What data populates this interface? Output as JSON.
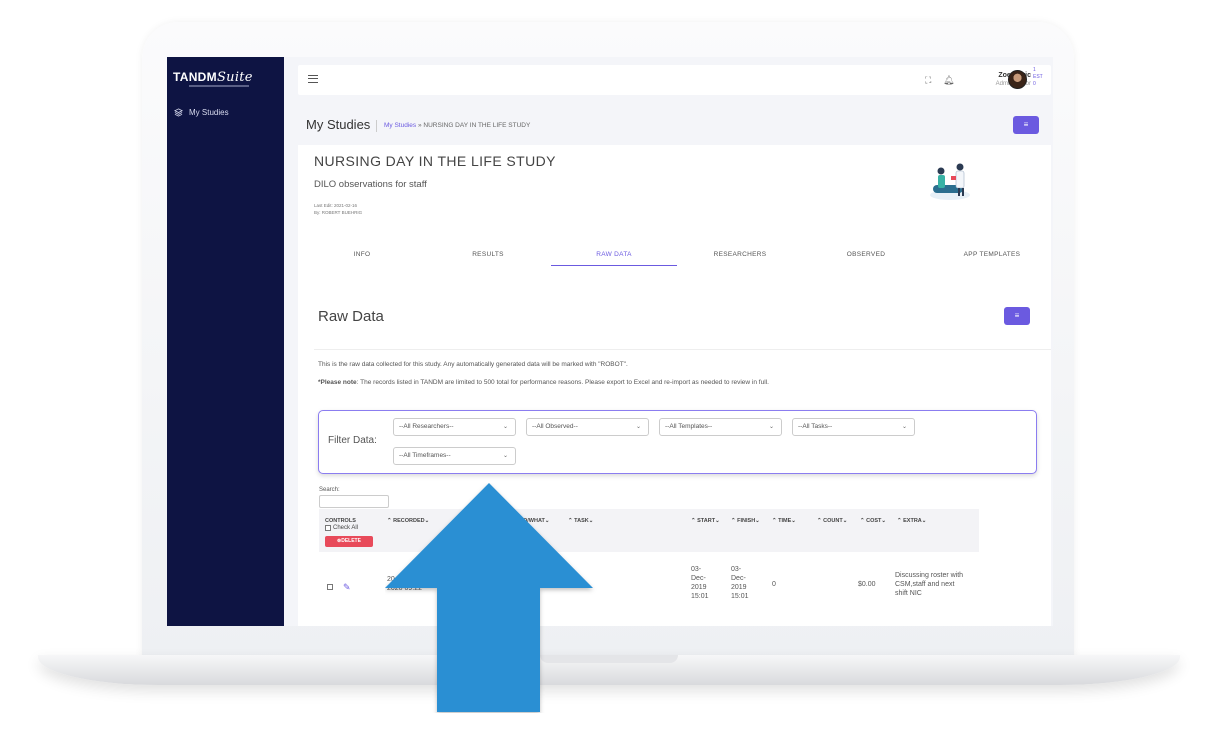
{
  "app": {
    "brand": "TANDM",
    "brand_script": "Suite"
  },
  "sidebar": {
    "items": [
      {
        "label": "My Studies",
        "icon": "layers-icon"
      }
    ]
  },
  "topbar": {
    "user_name": "Zoe Savic",
    "user_role": "Administrator",
    "mini_stats": [
      "1",
      "EST",
      "0"
    ]
  },
  "page": {
    "title": "My Studies",
    "breadcrumb_link": "My Studies",
    "breadcrumb_sep": "»",
    "breadcrumb_current": "NURSING DAY IN THE LIFE STUDY",
    "menu_label": "≡"
  },
  "study": {
    "title": "NURSING DAY IN THE LIFE STUDY",
    "subtitle": "DILO observations for staff",
    "last_edit": "Last Edit: 2021-02-16",
    "by": "By: ROBERT BUEHRIG"
  },
  "tabs": [
    {
      "label": "INFO",
      "active": false
    },
    {
      "label": "RESULTS",
      "active": false
    },
    {
      "label": "RAW DATA",
      "active": true
    },
    {
      "label": "RESEARCHERS",
      "active": false
    },
    {
      "label": "OBSERVED",
      "active": false
    },
    {
      "label": "APP TEMPLATES",
      "active": false
    }
  ],
  "raw": {
    "title": "Raw Data",
    "menu_label": "≡",
    "description": "This is the raw data collected for this study. Any automatically generated data will be marked with \"ROBOT\".",
    "note_bold": "*Please note",
    "note_text": ": The records listed in TANDM are limited to 500 total for performance reasons. Please export to Excel and re-import as needed to review in full."
  },
  "filter": {
    "label": "Filter Data:",
    "selects": [
      "--All Researchers--",
      "--All Observed--",
      "--All Templates--",
      "--All Tasks--",
      "--All Timeframes--"
    ]
  },
  "search": {
    "label": "Search:"
  },
  "table": {
    "controls_label": "CONTROLS",
    "check_all": "Check All",
    "delete_label": "⊗DELETE",
    "headers": [
      "RECORDED",
      "O/WHAT",
      "TASK",
      "START",
      "FINISH",
      "TIME",
      "COUNT",
      "COST",
      "EXTRA"
    ],
    "row": {
      "recorded": "20...",
      "recorded_2": "2020 09:22",
      "start": [
        "03-",
        "Dec-",
        "2019",
        "15:01"
      ],
      "finish": [
        "03-",
        "Dec-",
        "2019",
        "15:01"
      ],
      "time": "0",
      "cost": "$0.00",
      "extra": "Discussing roster with CSM,staff and next shift NIC"
    }
  },
  "colors": {
    "sidebar": "#0e1443",
    "accent": "#6b5ae0",
    "delete": "#e84a5a",
    "arrow": "#2b8fd3"
  }
}
